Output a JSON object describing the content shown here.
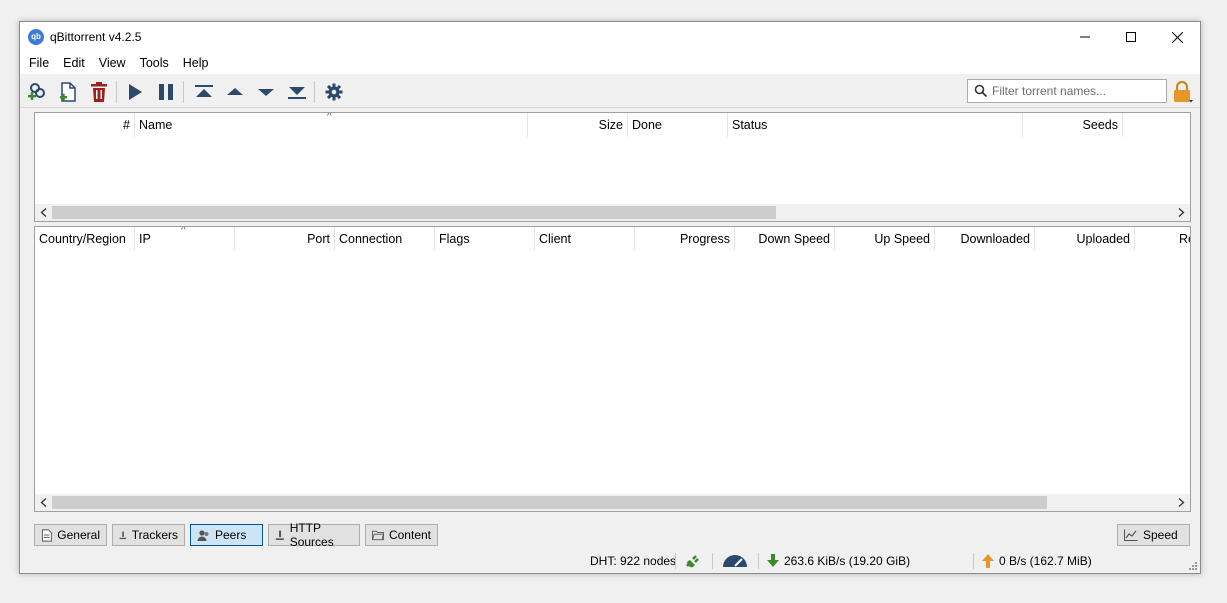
{
  "window": {
    "title": "qBittorrent v4.2.5",
    "app_icon_text": "qb"
  },
  "menu": [
    "File",
    "Edit",
    "View",
    "Tools",
    "Help"
  ],
  "toolbar": {
    "filter_placeholder": "Filter torrent names..."
  },
  "torrent_table": {
    "columns": [
      "#",
      "Name",
      "Size",
      "Done",
      "Status",
      "Seeds"
    ]
  },
  "peers_table": {
    "columns": [
      "Country/Region",
      "IP",
      "Port",
      "Connection",
      "Flags",
      "Client",
      "Progress",
      "Down Speed",
      "Up Speed",
      "Downloaded",
      "Uploaded",
      "Re"
    ]
  },
  "tabs": [
    "General",
    "Trackers",
    "Peers",
    "HTTP Sources",
    "Content"
  ],
  "active_tab": "Peers",
  "speed_button": "Speed",
  "status": {
    "dht": "DHT: 922 nodes",
    "download": "263.6 KiB/s (19.20 GiB)",
    "upload": "0 B/s (162.7 MiB)"
  },
  "colors": {
    "accent": "#3d7bd4",
    "green": "#3c8a2e",
    "red": "#a02020",
    "orange": "#e8962a",
    "toolbar_icon": "#2b4a6b"
  }
}
